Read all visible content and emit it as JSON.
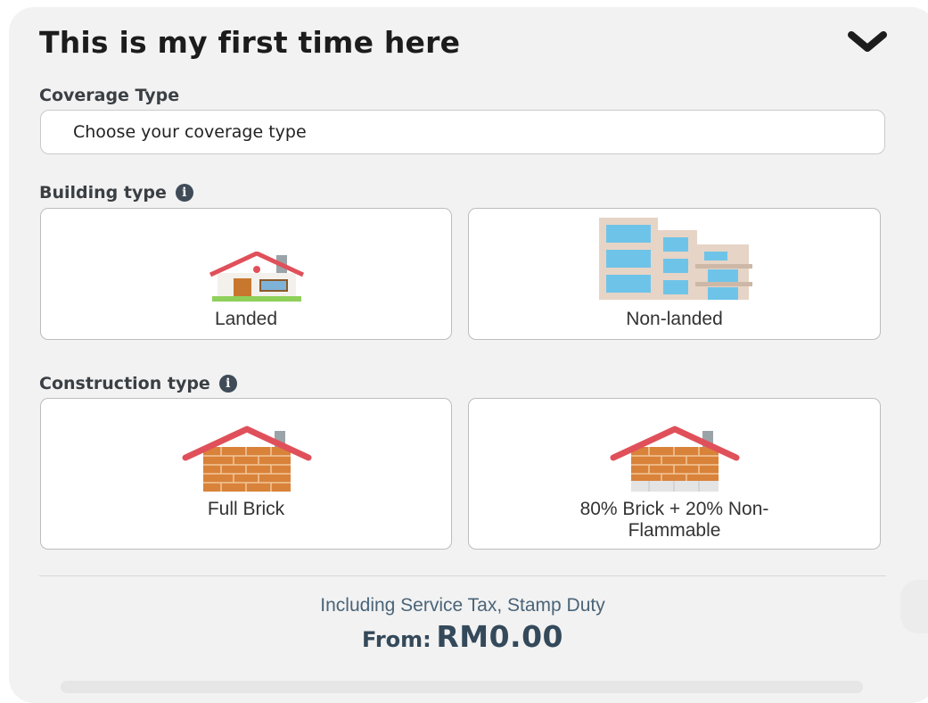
{
  "header": {
    "title": "This is my first time here",
    "toggle_icon": "chevron-down-icon"
  },
  "coverage": {
    "label": "Coverage Type",
    "value": "Choose your coverage type"
  },
  "building": {
    "label": "Building type",
    "info_icon": "info-icon",
    "options": [
      {
        "label": "Landed",
        "icon": "house-icon"
      },
      {
        "label": "Non-landed",
        "icon": "apartment-building-icon"
      }
    ]
  },
  "construction": {
    "label": "Construction type",
    "info_icon": "info-icon",
    "options": [
      {
        "label": "Full Brick",
        "icon": "brick-house-icon"
      },
      {
        "label_line1": "80% Brick + 20% Non-",
        "label_line2": "Flammable",
        "icon": "brick-house-partial-icon"
      }
    ]
  },
  "footer": {
    "tax_note": "Including Service Tax, Stamp Duty",
    "from_label": "From:",
    "amount": "RM0.00"
  },
  "colors": {
    "panel_bg": "#f2f2f2",
    "roof_red": "#e0505a",
    "brick_orange": "#d9823a",
    "price_text": "#34495a"
  }
}
